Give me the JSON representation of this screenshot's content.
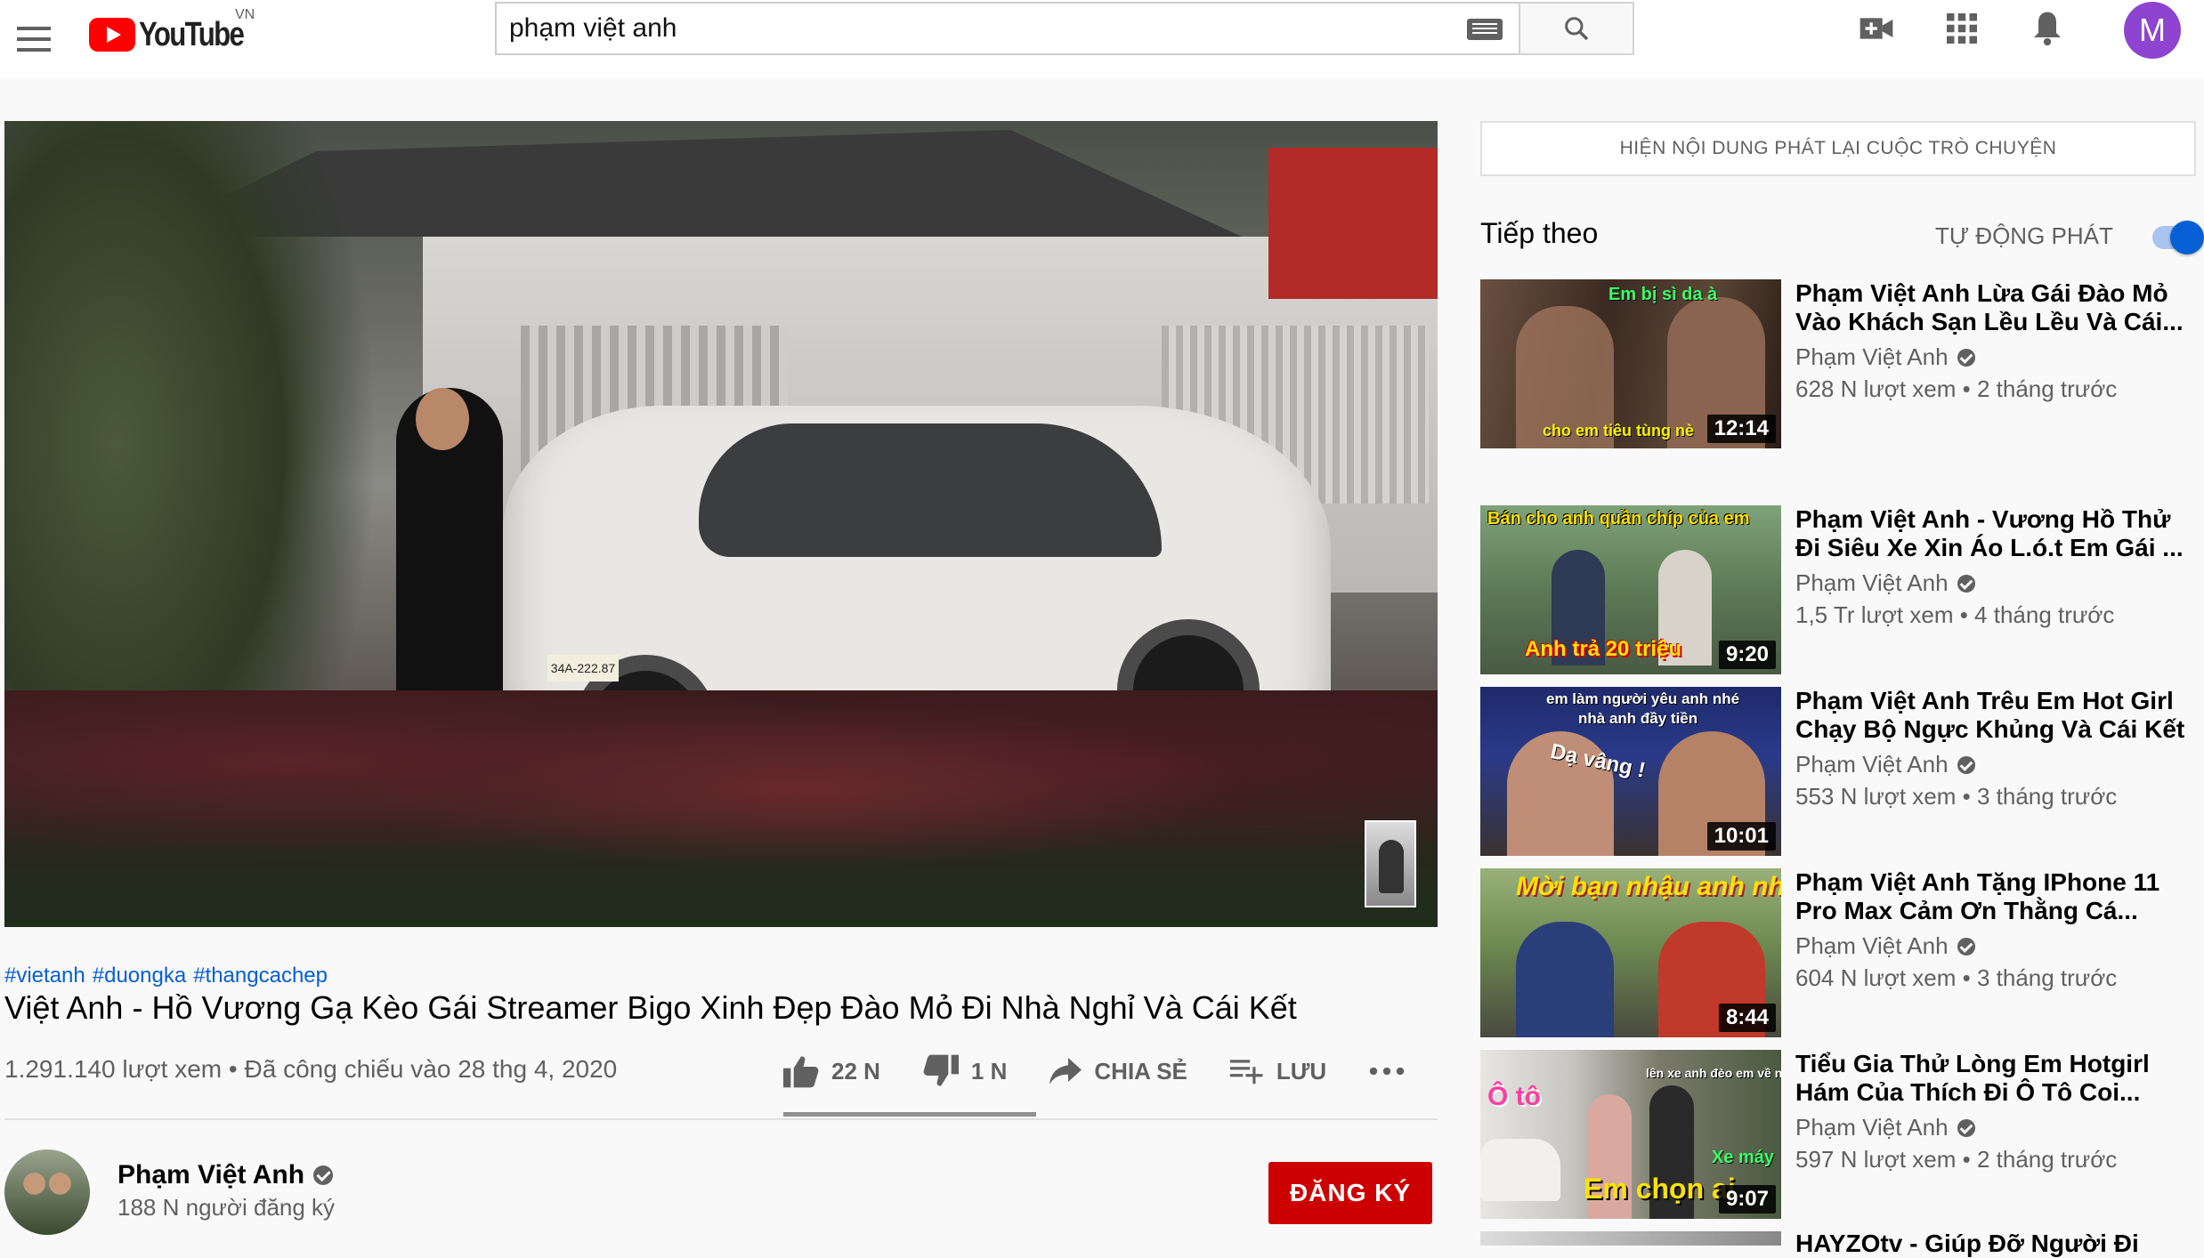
{
  "header": {
    "logo_text": "YouTube",
    "country": "VN",
    "search_value": "phạm việt anh",
    "avatar_letter": "M"
  },
  "video": {
    "hashtags": [
      "#vietanh",
      "#duongka",
      "#thangcachep"
    ],
    "title": "Việt Anh - Hồ Vương Gạ Kèo Gái Streamer Bigo Xinh Đẹp Đào Mỏ Đi Nhà Nghỉ Và Cái Kết",
    "views": "1.291.140 lượt xem",
    "premiered": "Đã công chiếu vào 28 thg 4, 2020",
    "likes": "22 N",
    "dislikes": "1 N",
    "share_label": "CHIA SẺ",
    "save_label": "LƯU",
    "plate": "34A-222.87"
  },
  "channel": {
    "name": "Phạm Việt Anh",
    "subscribers": "188 N người đăng ký",
    "subscribe_label": "ĐĂNG KÝ"
  },
  "sidebar": {
    "chat_replay_label": "HIỆN NỘI DUNG PHÁT LẠI CUỘC TRÒ CHUYỆN",
    "up_next_label": "Tiếp theo",
    "autoplay_label": "TỰ ĐỘNG PHÁT",
    "autoplay_on": true,
    "items": [
      {
        "title": "Phạm Việt Anh Lừa Gái Đào Mỏ Vào Khách Sạn Lều Lều Và Cái...",
        "channel": "Phạm Việt Anh",
        "meta": "628 N lượt xem • 2 tháng trước",
        "duration": "12:14",
        "captions": [
          "Em bị sì da à",
          "cho em tiêu tùng nè"
        ]
      },
      {
        "title": "Phạm Việt Anh - Vương Hồ Thử Đi Siêu Xe Xin Áo L.ó.t Em Gái ...",
        "channel": "Phạm Việt Anh",
        "meta": "1,5 Tr lượt xem • 4 tháng trước",
        "duration": "9:20",
        "captions": [
          "Bán cho anh quần chíp của em",
          "Anh trả 20 triệu"
        ]
      },
      {
        "title": "Phạm Việt Anh Trêu Em Hot Girl Chạy Bộ Ngực Khủng Và Cái Kết",
        "channel": "Phạm Việt Anh",
        "meta": "553 N lượt xem • 3 tháng trước",
        "duration": "10:01",
        "captions": [
          "em làm người yêu anh nhé",
          "nhà anh đầy tiền",
          "Dạ vâng !"
        ]
      },
      {
        "title": "Phạm Việt Anh Tặng IPhone 11 Pro Max Cảm Ơn Thằng Cá...",
        "channel": "Phạm Việt Anh",
        "meta": "604 N lượt xem • 3 tháng trước",
        "duration": "8:44",
        "captions": [
          "Mời bạn nhậu anh nhé"
        ]
      },
      {
        "title": "Tiểu Gia Thử Lòng Em Hotgirl Hám Của Thích Đi Ô Tô Coi...",
        "channel": "Phạm Việt Anh",
        "meta": "597 N lượt xem • 2 tháng trước",
        "duration": "9:07",
        "captions": [
          "Ô tô",
          "lên xe anh đèo em về nào",
          "Xe máy",
          "Em chọn ai"
        ]
      }
    ],
    "partial_title": "HAYZOtv - Giúp Đỡ Người Đi"
  },
  "colors": {
    "brand_red": "#ff0000",
    "subscribe_red": "#cc0000",
    "link_blue": "#065fd4",
    "avatar_purple": "#8e44d0"
  }
}
